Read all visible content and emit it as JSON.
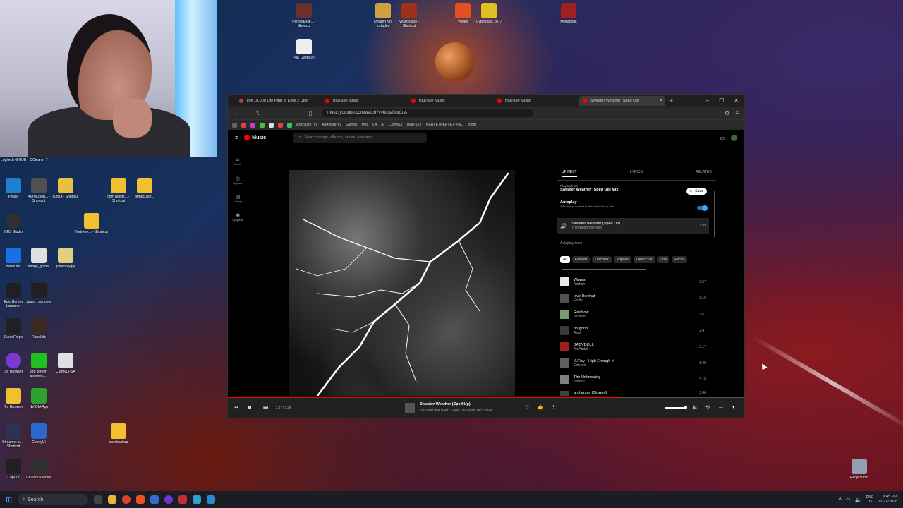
{
  "desktop": {
    "top_icons": [
      {
        "label": "PathOfExile... - Shortcut",
        "color": "#6a3030"
      },
      {
        "label": "PoE Overlay II",
        "color": "#eeeeee"
      },
      {
        "label": "Oxygen Not Included",
        "color": "#d0a040"
      },
      {
        "label": "VKings.exe - Shortcut",
        "color": "#a03018"
      },
      {
        "label": "Vortex",
        "color": "#e05020"
      },
      {
        "label": "Cyberpunk 2077",
        "color": "#e0c020"
      },
      {
        "label": "Megabonk",
        "color": "#a02020"
      }
    ],
    "left_icons": [
      {
        "label": "Logitech G HUB",
        "color": "#3a3a3a"
      },
      {
        "label": "CCleaner 7",
        "color": "#4a6a9a"
      },
      {
        "label": "Peace",
        "color": "#2080d0"
      },
      {
        "label": "AstroColon... - Shortcut",
        "color": "#505050"
      },
      {
        "label": "output - Shortcut",
        "color": "#e8c040"
      },
      {
        "label": "com.hvedit... - Shortcut",
        "color": "#f0c030"
      },
      {
        "label": "tempcusto...",
        "color": "#f0c030"
      },
      {
        "label": "OBS Studio",
        "color": "#303030"
      },
      {
        "label": "Network... - Shortcut",
        "color": "#f0c030"
      },
      {
        "label": "Battle.net",
        "color": "#1a70e0"
      },
      {
        "label": "mmge_gn.bat",
        "color": "#e0e0e0"
      },
      {
        "label": "pixelfairy.py",
        "color": "#e0d080"
      },
      {
        "label": "Epic Games Launcher",
        "color": "#202020"
      },
      {
        "label": "Jagex Launcher",
        "color": "#202020"
      },
      {
        "label": "CurseForge",
        "color": "#202020"
      },
      {
        "label": "RuneLite",
        "color": "#3a2a20"
      },
      {
        "label": "Tor Browser",
        "color": "#7a3ad0"
      },
      {
        "label": "brb screen annoying...",
        "color": "#20c020"
      },
      {
        "label": "ComfyUI-SA",
        "color": "#e0e0e0"
      },
      {
        "label": "Tor Browser",
        "color": "#f0c030"
      },
      {
        "label": "NVIDIA App",
        "color": "#30a030"
      },
      {
        "label": "Streamer.b... - Shortcut",
        "color": "#303050"
      },
      {
        "label": "ComfyUI",
        "color": "#2a6ad0"
      },
      {
        "label": "savebackup",
        "color": "#f0c030"
      },
      {
        "label": "CapCut",
        "color": "#202020"
      },
      {
        "label": "DaVinci Resolve",
        "color": "#303030"
      },
      {
        "label": "Recycle Bin",
        "color": "#90a0b0"
      }
    ]
  },
  "browser": {
    "tabs": [
      {
        "label": "The 18,000 Life Path of Exile 2 Uber",
        "active": false
      },
      {
        "label": "YouTube Music",
        "active": false
      },
      {
        "label": "YouTube Music",
        "active": false
      },
      {
        "label": "YouTube Music",
        "active": false
      },
      {
        "label": "Sweater Weather (Sped Up)",
        "active": true
      }
    ],
    "url": "music.youtube.com/watch?v=ltdqa0kxCuA",
    "bookmarks": [
      "Astropath_TV",
      "AstropathTV",
      "Games",
      "Mod",
      "LA",
      "AI",
      "ComfyUI",
      "Wan-S2V",
      "NERVE (NERVE) - Pu...",
      "room"
    ]
  },
  "ytm": {
    "logo": "Music",
    "search_placeholder": "Search songs, albums, artists, podcasts",
    "nav": [
      "Home",
      "Explore",
      "Library",
      "Upgrade"
    ],
    "panel_tabs": [
      "UP NEXT",
      "LYRICS",
      "RELATED"
    ],
    "playing_from_label": "Playing from",
    "playing_from": "Sweater Weather (Sped Up) Mix",
    "save": "Save",
    "autoplay": "Autoplay",
    "autoplay_sub": "Add similar content to the end of the queue",
    "current": {
      "title": "Sweater Weather (Sped Up)",
      "artist": "The Neighbourhood",
      "duration": "3:39"
    },
    "autoplay_on": "Autoplay is on",
    "chips": [
      "All",
      "Familiar",
      "Discover",
      "Popular",
      "Deep cuts",
      "Chill",
      "Focus"
    ],
    "queue": [
      {
        "title": "Waves",
        "artist": "Nathan",
        "duration": "2:57",
        "color": "#e8e8e8"
      },
      {
        "title": "love like that",
        "artist": "Endie",
        "duration": "3:10",
        "color": "#505050"
      },
      {
        "title": "Rainbow",
        "artist": "Jesse®",
        "duration": "2:57",
        "color": "#7a9a70"
      },
      {
        "title": "no good",
        "artist": "Asal",
        "duration": "2:47",
        "color": "#3a3a3a"
      },
      {
        "title": "BABYDOLL",
        "artist": "Ari Abdul",
        "duration": "3:17",
        "color": "#a02020"
      },
      {
        "title": "K.Flay - High Enough ☆",
        "artist": "Génesis",
        "duration": "3:49",
        "color": "#606060"
      },
      {
        "title": "The Unknowing",
        "artist": "Jfarrari",
        "duration": "3:18",
        "color": "#808080"
      },
      {
        "title": "archangel (Slowed)",
        "artist": "",
        "duration": "3:06",
        "color": "#404040"
      }
    ],
    "player": {
      "time": "2:47 / 3:39",
      "title": "Sweater Weather (Sped Up)",
      "subtitle": "The Neighbourhood • I Love You. (Sped Up) • 2013",
      "progress": 0.76
    }
  },
  "taskbar": {
    "search": "Search",
    "lang": "ENG",
    "region": "US",
    "time": "9:45 PM",
    "date": "12/27/2025"
  }
}
